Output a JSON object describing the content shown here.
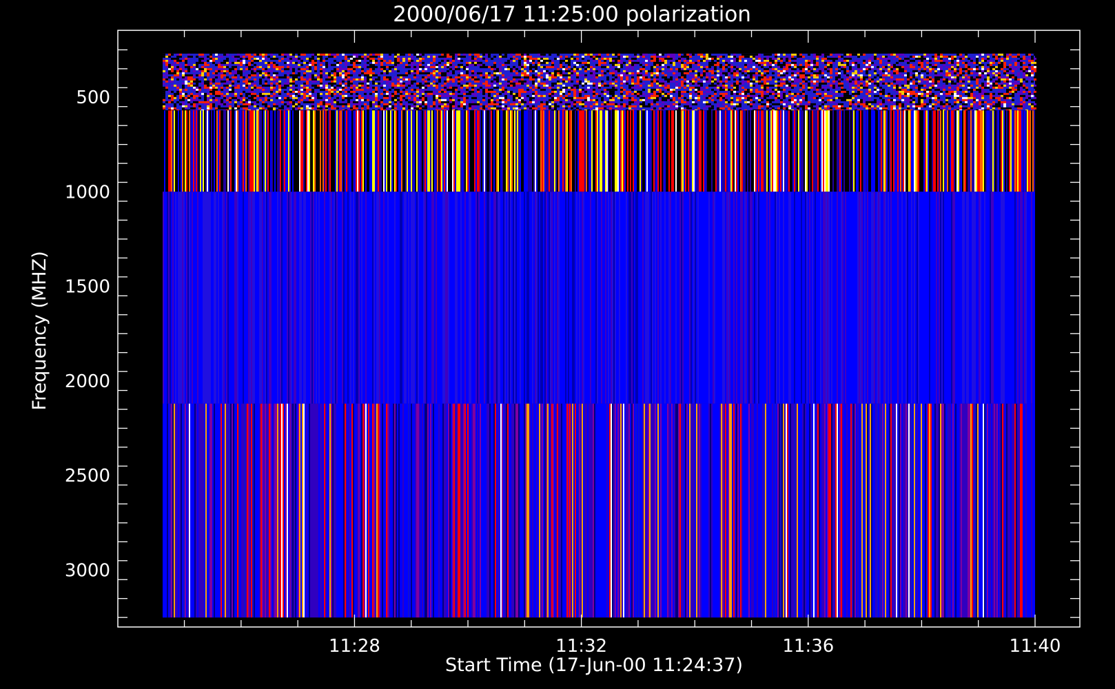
{
  "chart_data": {
    "type": "heatmap",
    "title": "2000/06/17 11:25:00 polarization",
    "xlabel": "Start Time (17-Jun-00 11:24:37)",
    "ylabel": "Frequency (MHZ)",
    "x_ticks": [
      "11:28",
      "11:32",
      "11:36",
      "11:40"
    ],
    "y_ticks": [
      "500",
      "1000",
      "1500",
      "2000",
      "2500",
      "3000"
    ],
    "x_range": [
      "11:24:37",
      "11:40:00"
    ],
    "y_range": [
      3250,
      200
    ],
    "bands": [
      {
        "freq_range": [
          270,
          570
        ],
        "texture": "speckled",
        "base_color": "#2020d0"
      },
      {
        "freq_range": [
          570,
          1000
        ],
        "texture": "striped",
        "base_color": "#000000"
      },
      {
        "freq_range": [
          1000,
          2120
        ],
        "texture": "striped",
        "base_color": "#0000ff"
      },
      {
        "freq_range": [
          2120,
          3250
        ],
        "texture": "striped",
        "base_color": "#1010e0"
      }
    ],
    "colormap": [
      "#000000",
      "#0000ff",
      "#ff0000",
      "#ffff00",
      "#ffffff"
    ]
  }
}
